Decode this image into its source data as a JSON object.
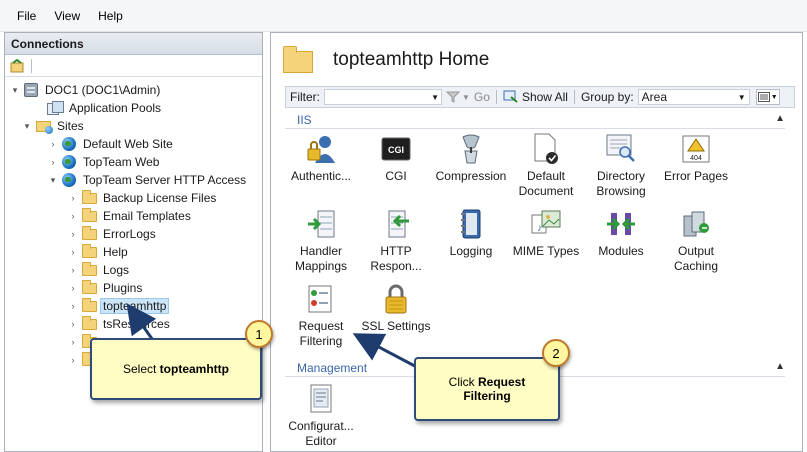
{
  "menu": [
    "File",
    "View",
    "Help"
  ],
  "connections": {
    "header": "Connections",
    "tree": [
      {
        "label": "DOC1 (DOC1\\Admin)",
        "icon": "server-icon"
      },
      {
        "label": "Application Pools",
        "icon": "app-pools-icon"
      },
      {
        "label": "Sites",
        "icon": "sites-icon"
      },
      {
        "label": "Default Web Site",
        "icon": "globe-icon"
      },
      {
        "label": "TopTeam Web",
        "icon": "globe-icon"
      },
      {
        "label": "TopTeam Server HTTP Access",
        "icon": "globe-icon"
      },
      {
        "label": "Backup License Files",
        "icon": "folder-icon"
      },
      {
        "label": "Email Templates",
        "icon": "folder-icon"
      },
      {
        "label": "ErrorLogs",
        "icon": "folder-icon"
      },
      {
        "label": "Help",
        "icon": "folder-icon"
      },
      {
        "label": "Logs",
        "icon": "folder-icon"
      },
      {
        "label": "Plugins",
        "icon": "folder-icon"
      },
      {
        "label": "topteamhttp",
        "icon": "folder-icon"
      },
      {
        "label": "tsResources",
        "icon": "folder-icon"
      }
    ]
  },
  "home": {
    "title": "topteamhttp Home"
  },
  "filterbar": {
    "filter_label": "Filter:",
    "go_label": "Go",
    "show_all_label": "Show All",
    "group_by_label": "Group by:",
    "group_by_value": "Area"
  },
  "sections": {
    "iis": "IIS",
    "management": "Management"
  },
  "features": {
    "authentication": "Authentic...",
    "cgi": "CGI",
    "compression": "Compression",
    "default_document_1": "Default",
    "default_document_2": "Document",
    "directory_browsing_1": "Directory",
    "directory_browsing_2": "Browsing",
    "error_pages": "Error Pages",
    "handler_mappings_1": "Handler",
    "handler_mappings_2": "Mappings",
    "http_response_1": "HTTP",
    "http_response_2": "Respon...",
    "logging": "Logging",
    "mime_types": "MIME Types",
    "modules": "Modules",
    "output_caching_1": "Output",
    "output_caching_2": "Caching",
    "request_filtering_1": "Request",
    "request_filtering_2": "Filtering",
    "ssl_settings": "SSL Settings",
    "config_editor_1": "Configurat...",
    "config_editor_2": "Editor",
    "cgi_icon_text": "CGI",
    "error_icon_text": "404"
  },
  "callouts": {
    "step1_badge": "1",
    "step1_prefix": "Select ",
    "step1_bold": "topteamhttp",
    "step2_badge": "2",
    "step2_prefix": "Click ",
    "step2_bold_1": "Request",
    "step2_bold_2": "Filtering"
  }
}
